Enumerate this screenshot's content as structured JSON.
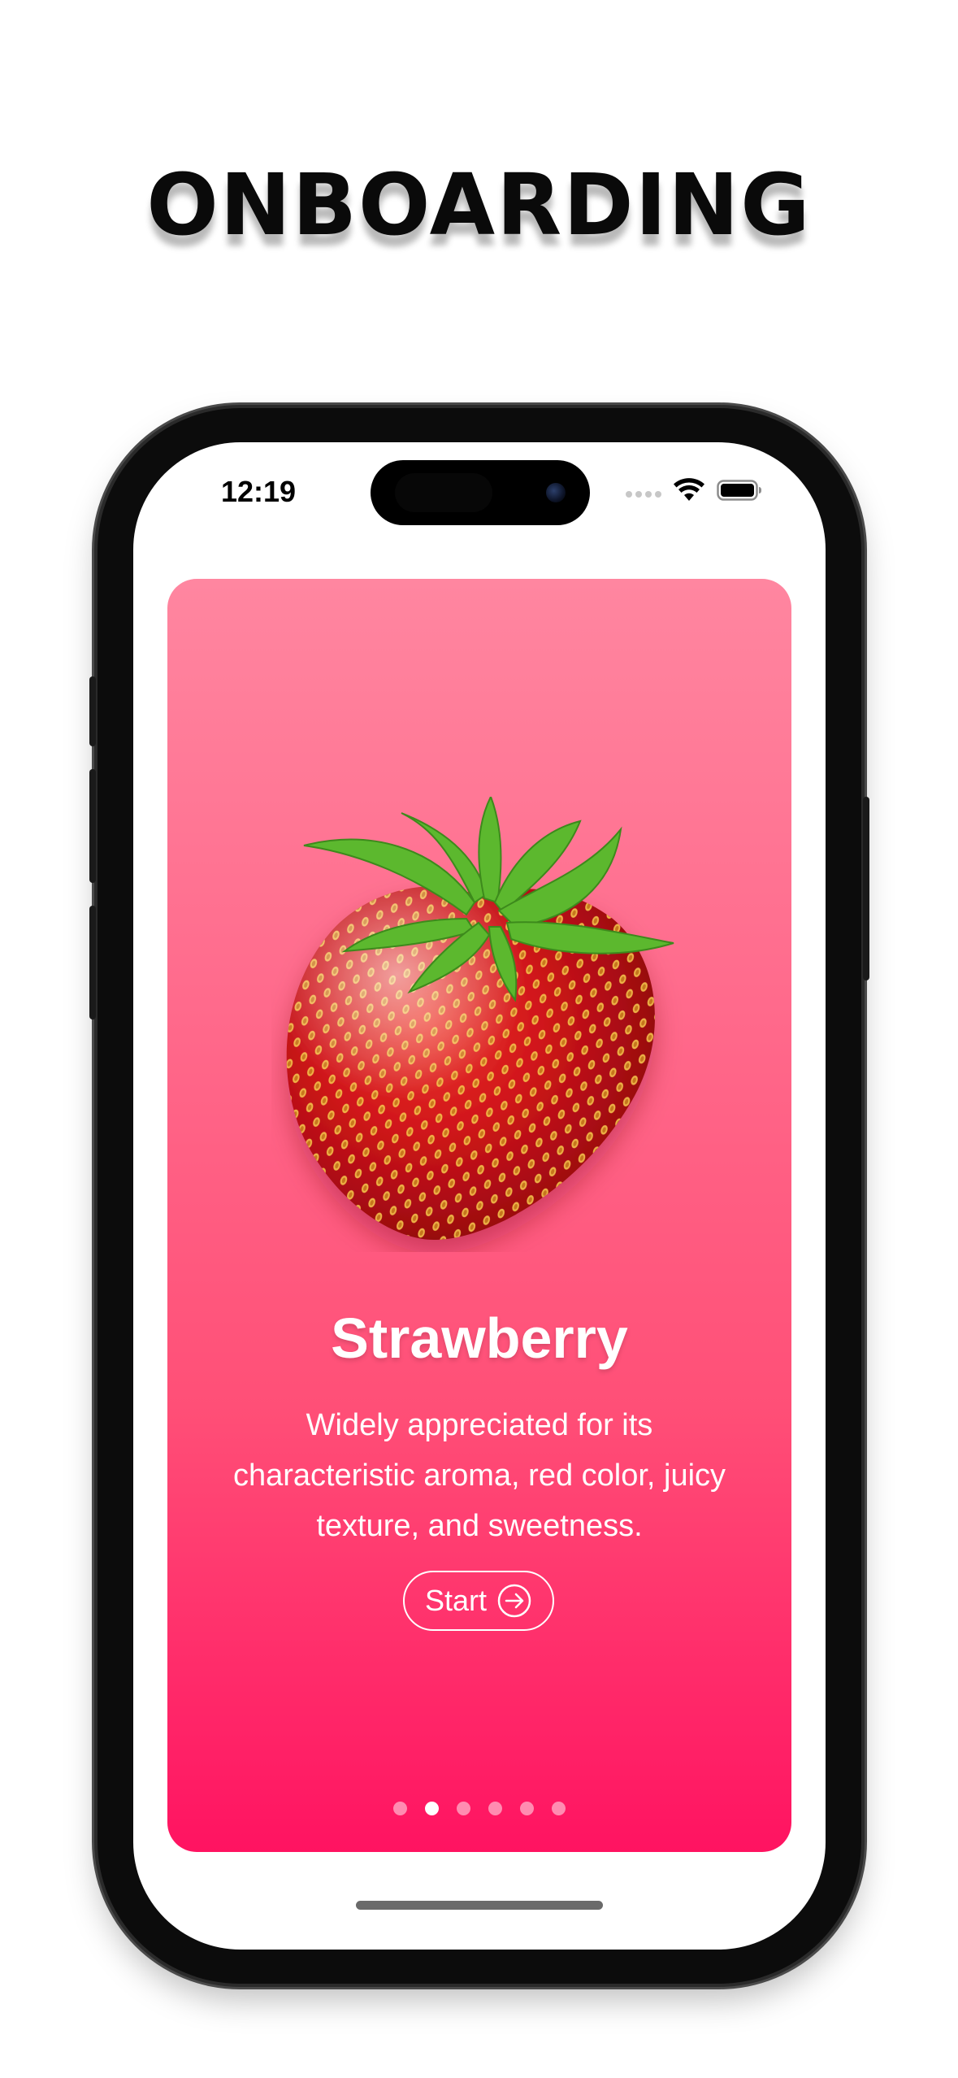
{
  "heading": "ONBOARDING",
  "status_bar": {
    "time": "12:19",
    "wifi_icon": "wifi-icon",
    "battery_icon": "battery-icon"
  },
  "card": {
    "gradient_top": "#ff86a0",
    "gradient_bottom": "#ff1361",
    "image_icon": "strawberry-image",
    "title": "Strawberry",
    "description": "Widely appreciated for its\ncharacteristic aroma,  red color, juicy\ntexture, and sweetness.",
    "start_button": {
      "label": "Start",
      "icon": "arrow-right-circle-icon"
    },
    "pagination": {
      "total": 6,
      "active_index": 1
    }
  }
}
